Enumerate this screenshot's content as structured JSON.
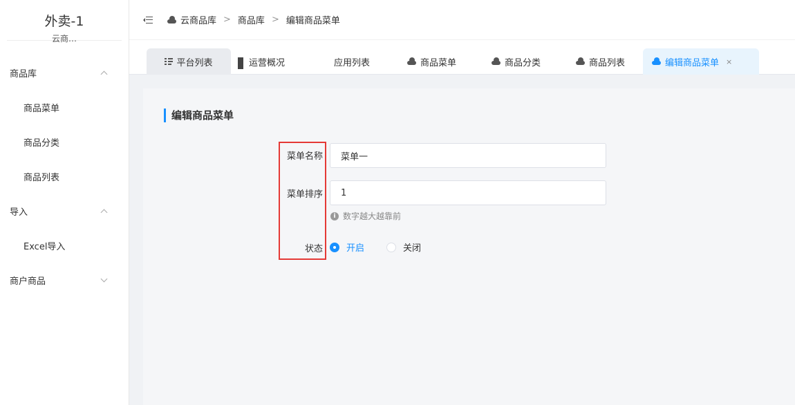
{
  "sidebar": {
    "app_name": "外卖-1",
    "app_sub": "云商…",
    "groups": [
      {
        "label": "商品库",
        "items": [
          "商品菜单",
          "商品分类",
          "商品列表"
        ]
      },
      {
        "label": "导入",
        "items": [
          "Excel导入"
        ]
      },
      {
        "label": "商户商品",
        "items": []
      }
    ]
  },
  "header": {
    "breadcrumb": [
      "云商品库",
      "商品库",
      "编辑商品菜单"
    ],
    "separator": ">"
  },
  "tabs": [
    {
      "label": "平台列表",
      "icon": "list-icon"
    },
    {
      "label": "运营概况",
      "icon": "grid-icon"
    },
    {
      "label": "应用列表",
      "icon": "apps-icon"
    },
    {
      "label": "商品菜单",
      "icon": "cloud-icon"
    },
    {
      "label": "商品分类",
      "icon": "cloud-icon"
    },
    {
      "label": "商品列表",
      "icon": "cloud-icon"
    },
    {
      "label": "编辑商品菜单",
      "icon": "cloud-icon",
      "active": true,
      "close": "×"
    }
  ],
  "form": {
    "title": "编辑商品菜单",
    "name_label": "菜单名称",
    "name_value": "菜单一",
    "sort_label": "菜单排序",
    "sort_value": "1",
    "sort_hint": "数字越大越靠前",
    "status_label": "状态",
    "status_options": [
      "开启",
      "关闭"
    ],
    "status_selected": "开启"
  },
  "colors": {
    "accent": "#1890ff",
    "highlight_box": "#e53935"
  }
}
